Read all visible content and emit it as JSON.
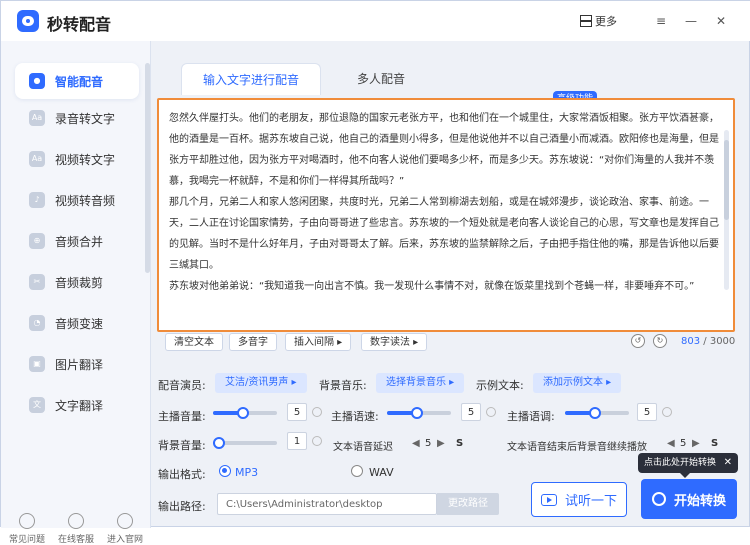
{
  "app": {
    "title": "秒转配音",
    "more_label": "更多"
  },
  "sidebar": {
    "items": [
      {
        "label": "智能配音",
        "active": true
      },
      {
        "label": "录音转文字"
      },
      {
        "label": "视频转文字"
      },
      {
        "label": "视频转音频"
      },
      {
        "label": "音频合并"
      },
      {
        "label": "音频裁剪"
      },
      {
        "label": "音频变速"
      },
      {
        "label": "图片翻译"
      },
      {
        "label": "文字翻译"
      }
    ],
    "footer": [
      {
        "label": "常见问题"
      },
      {
        "label": "在线客服"
      },
      {
        "label": "进入官网"
      }
    ]
  },
  "tabs": [
    {
      "label": "输入文字进行配音",
      "active": true
    },
    {
      "label": "多人配音"
    }
  ],
  "badge": "高级功能",
  "editor": {
    "paragraphs": [
      "忽然久伴屋打头。他们的老朋友，那位退隐的国家元老张方平，也和他们在一个城里住，大家常酒饭相聚。张方平饮酒甚豪，他的酒量是一百杯。据苏东坡自己说，他自己的酒量则小得多，但是他说他并不以自己酒量小而减酒。欧阳修也是海量，但是张方平却胜过他，因为张方平对喝酒时，他不向客人说他们要喝多少杯，而是多少天。苏东坡说：“对你们海量的人我并不羡慕，我喝完一杯就醉，不是和你们一样得其所哉吗？”",
      "那几个月，兄弟二人和家人悠闲团聚，共度时光，兄弟二人常到柳湖去划船，或是在城郊漫步，谈论政治、家事、前途。一天，二人正在讨论国家情势，子由向哥哥进了些忠言。苏东坡的一个短处就是老向客人谈论自己的心思，写文章也是发挥自己的见解。当时不是什么好年月，子由对哥哥太了解。后来，苏东坡的监禁解除之后，子由把手指住他的嘴，那是告诉他以后要三缄其口。",
      "苏东坡对他弟弟说：“我知道我一向出言不慎。我一发现什么事情不对，就像在饭菜里找到个苍蝇一样，非要唾弃不可。”"
    ],
    "tools": [
      {
        "label": "清空文本"
      },
      {
        "label": "多音字"
      },
      {
        "label": "插入间隔 ▸"
      },
      {
        "label": "数字读法 ▸"
      }
    ],
    "count_current": "803",
    "count_max": "/ 3000"
  },
  "settings": {
    "voice_label": "配音演员:",
    "voice_value": "艾洁/资讯男声 ▸",
    "music_label": "背景音乐:",
    "music_value": "选择背景音乐 ▸",
    "example_label": "示例文本:",
    "example_value": "添加示例文本 ▸",
    "vol_label": "主播音量:",
    "vol_value": "5",
    "speed_label": "主播语速:",
    "speed_value": "5",
    "pitch_label": "主播语调:",
    "pitch_value": "5",
    "bgvol_label": "背景音量:",
    "bgvol_value": "1",
    "delay_label": "文本语音延迟",
    "delay_value": "5",
    "delay_unit": "S",
    "after_label": "文本语音结束后背景音继续播放",
    "after_value": "5",
    "after_unit": "S"
  },
  "output": {
    "format_label": "输出格式:",
    "mp3": "MP3",
    "wav": "WAV",
    "path_label": "输出路径:",
    "path_value": "C:\\Users\\Administrator\\desktop",
    "change_path": "更改路径"
  },
  "actions": {
    "try": "试听一下",
    "start": "开始转换",
    "tooltip": "点击此处开始转换",
    "tooltip_close": "✕"
  },
  "colors": {
    "accent": "#2f6bff",
    "border_highlight": "#f08c3a"
  }
}
